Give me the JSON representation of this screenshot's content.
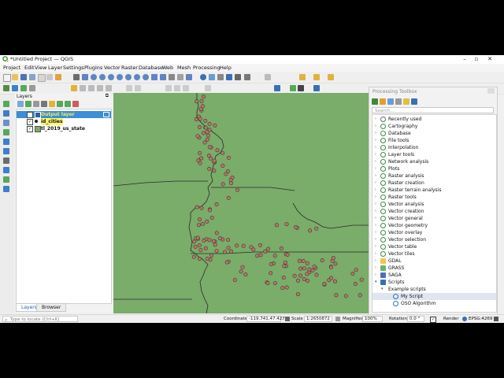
{
  "window": {
    "title": "*Untitled Project — QGIS"
  },
  "menu": [
    "Project",
    "Edit",
    "View",
    "Layer",
    "Settings",
    "Plugins",
    "Vector",
    "Raster",
    "Database",
    "Web",
    "Mesh",
    "Processing",
    "Help"
  ],
  "layers_panel": {
    "title": "Layers",
    "items": [
      {
        "label": "Output layer",
        "checked": true,
        "selected": true,
        "highlight_color": "#3a8fd6"
      },
      {
        "label": "id_cities",
        "checked": true,
        "selected": false,
        "symbol_color": "#222222"
      },
      {
        "label": "tl_2019_us_state",
        "checked": true,
        "selected": false,
        "symbol_color": "#7aac6a"
      }
    ],
    "tabs": [
      "Layers",
      "Browser"
    ]
  },
  "toolbox": {
    "title": "Processing Toolbox",
    "search_placeholder": "Search...",
    "items": [
      {
        "label": "Recently used",
        "icon": "clock-icon"
      },
      {
        "label": "Cartography",
        "icon": "qgis-icon"
      },
      {
        "label": "Database",
        "icon": "qgis-icon"
      },
      {
        "label": "File tools",
        "icon": "qgis-icon"
      },
      {
        "label": "Interpolation",
        "icon": "qgis-icon"
      },
      {
        "label": "Layer tools",
        "icon": "qgis-icon"
      },
      {
        "label": "Network analysis",
        "icon": "qgis-icon"
      },
      {
        "label": "Plots",
        "icon": "qgis-icon"
      },
      {
        "label": "Raster analysis",
        "icon": "qgis-icon"
      },
      {
        "label": "Raster creation",
        "icon": "qgis-icon"
      },
      {
        "label": "Raster terrain analysis",
        "icon": "qgis-icon"
      },
      {
        "label": "Raster tools",
        "icon": "qgis-icon"
      },
      {
        "label": "Vector analysis",
        "icon": "qgis-icon"
      },
      {
        "label": "Vector creation",
        "icon": "qgis-icon"
      },
      {
        "label": "Vector general",
        "icon": "qgis-icon"
      },
      {
        "label": "Vector geometry",
        "icon": "qgis-icon"
      },
      {
        "label": "Vector overlay",
        "icon": "qgis-icon"
      },
      {
        "label": "Vector selection",
        "icon": "qgis-icon"
      },
      {
        "label": "Vector table",
        "icon": "qgis-icon"
      },
      {
        "label": "Vector tiles",
        "icon": "qgis-icon"
      },
      {
        "label": "GDAL",
        "icon": "gdal-icon"
      },
      {
        "label": "GRASS",
        "icon": "grass-icon"
      },
      {
        "label": "SAGA",
        "icon": "saga-icon"
      },
      {
        "label": "Scripts",
        "icon": "python-icon",
        "expanded": true
      },
      {
        "label": "Example scripts",
        "icon": "none",
        "expanded": true
      },
      {
        "label": "My Script",
        "icon": "gear-icon",
        "selected": true
      },
      {
        "label": "OSO Algorithm",
        "icon": "gear-icon"
      }
    ]
  },
  "status": {
    "locator_placeholder": "Type to locate (Ctrl+K)",
    "coordinate_label": "Coordinate",
    "coordinate_value": "-119.741,47.427",
    "scale_label": "Scale",
    "scale_value": "1:2650872",
    "magnifier_label": "Magnifier",
    "magnifier_value": "100%",
    "rotation_label": "Rotation",
    "rotation_value": "0.0 °",
    "render_label": "Render",
    "crs": "EPSG:4269"
  },
  "colors": {
    "map_fill": "#7aac6a",
    "city_point": "#b07a6e",
    "accent": "#3a8fd6"
  }
}
